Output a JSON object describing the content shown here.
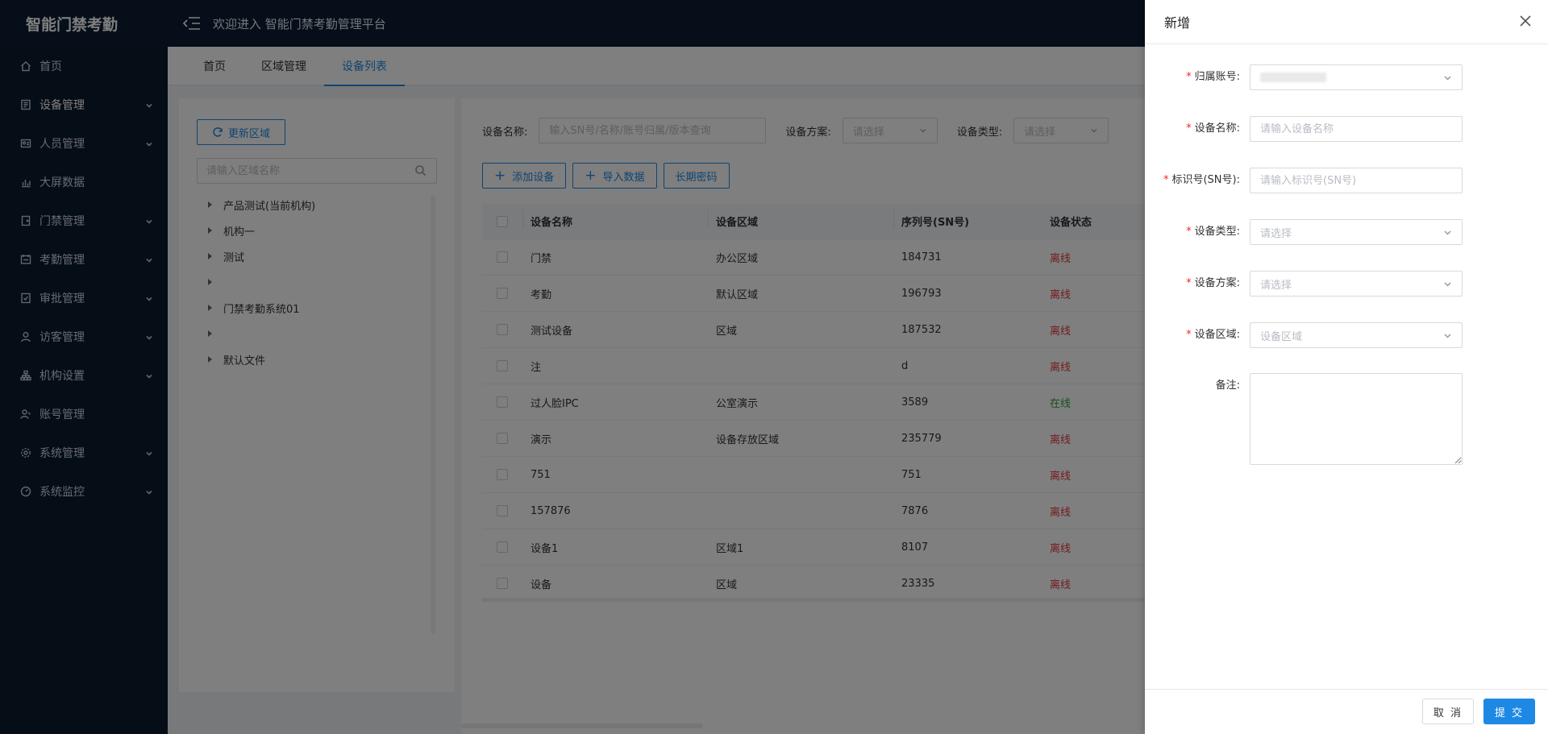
{
  "app": {
    "logo": "智能门禁考勤",
    "welcome": "欢迎进入 智能门禁考勤管理平台"
  },
  "sidebar": {
    "items": [
      {
        "label": "首页",
        "icon": "home-icon",
        "has_children": false
      },
      {
        "label": "设备管理",
        "icon": "device-icon",
        "has_children": true
      },
      {
        "label": "人员管理",
        "icon": "person-card-icon",
        "has_children": true
      },
      {
        "label": "大屏数据",
        "icon": "bar-chart-icon",
        "has_children": false
      },
      {
        "label": "门禁管理",
        "icon": "door-icon",
        "has_children": true
      },
      {
        "label": "考勤管理",
        "icon": "attendance-icon",
        "has_children": true
      },
      {
        "label": "审批管理",
        "icon": "approval-icon",
        "has_children": true
      },
      {
        "label": "访客管理",
        "icon": "user-icon",
        "has_children": true
      },
      {
        "label": "机构设置",
        "icon": "org-icon",
        "has_children": true
      },
      {
        "label": "账号管理",
        "icon": "account-icon",
        "has_children": false
      },
      {
        "label": "系统管理",
        "icon": "gear-icon",
        "has_children": true
      },
      {
        "label": "系统监控",
        "icon": "dashboard-icon",
        "has_children": true
      }
    ]
  },
  "tabs": [
    {
      "label": "首页",
      "active": false
    },
    {
      "label": "区域管理",
      "active": false
    },
    {
      "label": "设备列表",
      "active": true
    }
  ],
  "area_panel": {
    "refresh_label": "更新区域",
    "search_placeholder": "请输入区域名称",
    "tree": [
      "产品测试(当前机构)",
      "机构一",
      "测试",
      "",
      "门禁考勤系统01",
      "",
      "默认文件"
    ]
  },
  "filters": {
    "device_name_label": "设备名称:",
    "device_name_placeholder": "输入SN号/名称/账号归属/版本查询",
    "scheme_label": "设备方案:",
    "scheme_placeholder": "请选择",
    "type_label": "设备类型:",
    "type_placeholder": "请选择"
  },
  "actions": {
    "add_device": "添加设备",
    "import_data": "导入数据",
    "long_password": "长期密码"
  },
  "table": {
    "headers": {
      "name": "设备名称",
      "area": "设备区域",
      "sn": "序列号(SN号)",
      "status": "设备状态"
    },
    "rows": [
      {
        "name": "门禁",
        "area": "办公区域",
        "sn": "184731",
        "status": "离线"
      },
      {
        "name": "考勤",
        "area": "默认区域",
        "sn": "196793",
        "status": "离线"
      },
      {
        "name": "测试设备",
        "area": "区域",
        "sn": "187532",
        "status": "离线"
      },
      {
        "name": "注",
        "area": "",
        "sn": "d",
        "status": "离线"
      },
      {
        "name": "过人脸IPC",
        "area": "公室演示",
        "sn": "3589",
        "status": "在线"
      },
      {
        "name": "演示",
        "area": "设备存放区域",
        "sn": "235779",
        "status": "离线"
      },
      {
        "name": "751",
        "area": "",
        "sn": "751",
        "status": "离线"
      },
      {
        "name": "157876",
        "area": "",
        "sn": "7876",
        "status": "离线"
      },
      {
        "name": "设备1",
        "area": "区域1",
        "sn": "8107",
        "status": "离线"
      },
      {
        "name": "设备",
        "area": "区域",
        "sn": "23335",
        "status": "离线"
      }
    ],
    "status_colors": {
      "离线": "#e6373b",
      "在线": "#2aa13d"
    }
  },
  "drawer": {
    "title": "新增",
    "fields": {
      "account_label": "归属账号:",
      "name_label": "设备名称:",
      "name_placeholder": "请输入设备名称",
      "sn_label": "标识号(SN号):",
      "sn_placeholder": "请输入标识号(SN号)",
      "type_label": "设备类型:",
      "type_placeholder": "请选择",
      "scheme_label": "设备方案:",
      "scheme_placeholder": "请选择",
      "area_label": "设备区域:",
      "area_placeholder": "设备区域",
      "remark_label": "备注:"
    },
    "cancel": "取 消",
    "submit": "提 交"
  },
  "colors": {
    "primary": "#1d89e4",
    "sidebar_bg": "#0a1a2f",
    "required": "#f5222d"
  }
}
